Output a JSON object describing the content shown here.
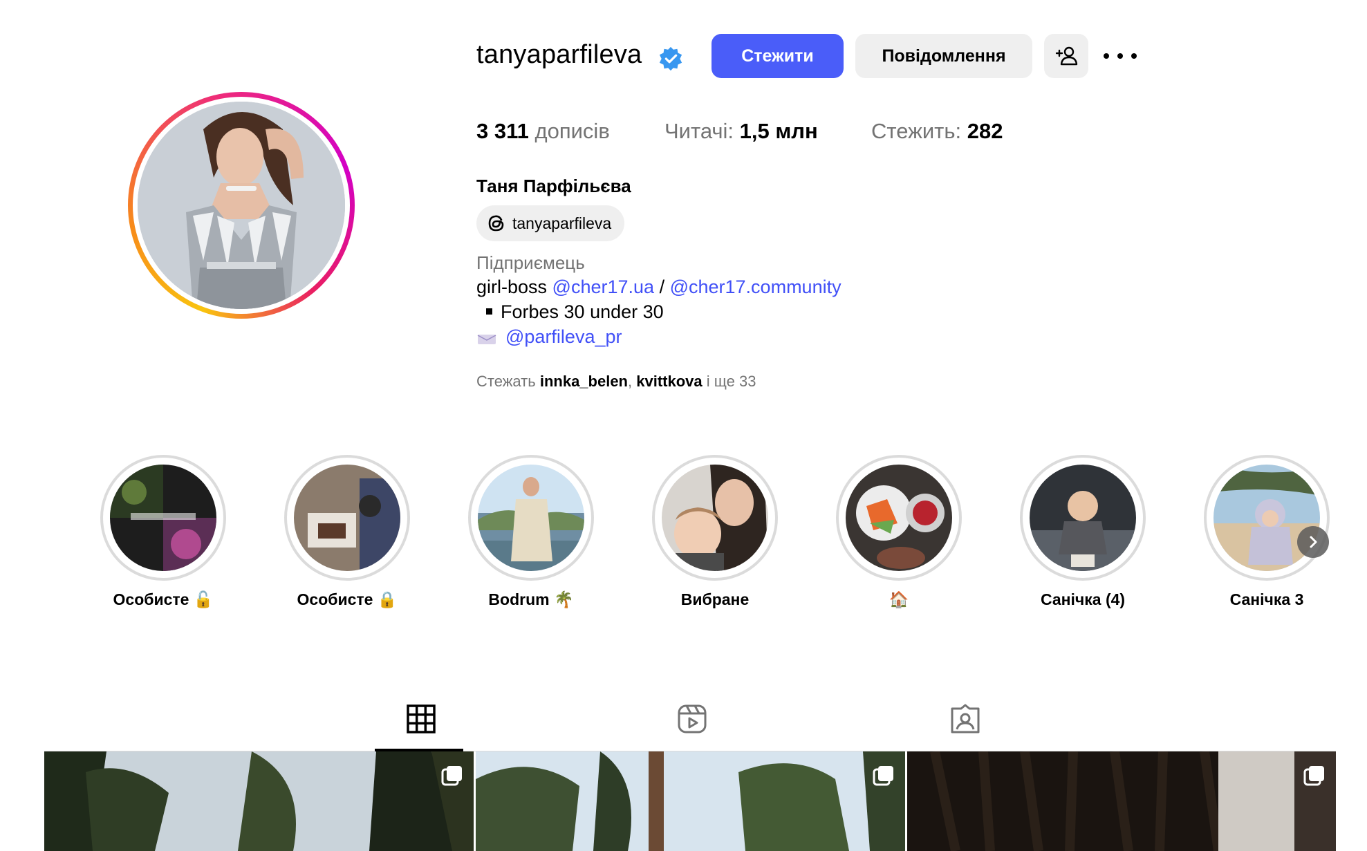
{
  "profile": {
    "username": "tanyaparfileva",
    "follow_label": "Стежити",
    "message_label": "Повідомлення",
    "stats": {
      "posts_value": "3 311",
      "posts_label": "дописів",
      "followers_label": "Читачі:",
      "followers_value": "1,5 млн",
      "following_label": "Стежить:",
      "following_value": "282"
    },
    "full_name": "Таня Парфільєва",
    "threads_handle": "tanyaparfileva",
    "category": "Підприємець",
    "bio": {
      "line1_text": "girl-boss",
      "line1_link1": "@cher17.ua",
      "line1_sep": "/",
      "line1_link2": "@cher17.community",
      "line2_text": "Forbes 30 under 30",
      "line3_link": "@parfileva_pr"
    },
    "followed_by": {
      "prefix": "Стежать",
      "user1": "innka_belen",
      "comma": ",",
      "user2": "kvittkova",
      "suffix": "і ще 33"
    }
  },
  "highlights": [
    {
      "label": "Особисте 🔓"
    },
    {
      "label": "Особисте 🔒"
    },
    {
      "label": "Bodrum 🌴"
    },
    {
      "label": "Вибране"
    },
    {
      "label": "🏠"
    },
    {
      "label": "Санічка (4)"
    },
    {
      "label": "Санічка 3"
    }
  ],
  "tabs": [
    {
      "name": "posts-grid-icon",
      "active": true
    },
    {
      "name": "reels-icon",
      "active": false
    },
    {
      "name": "tagged-icon",
      "active": false
    }
  ],
  "colors": {
    "primary_button": "#4a5df9",
    "link": "#4150f7",
    "secondary_button": "#efefef",
    "muted_text": "#737373",
    "verified": "#3897f0"
  }
}
